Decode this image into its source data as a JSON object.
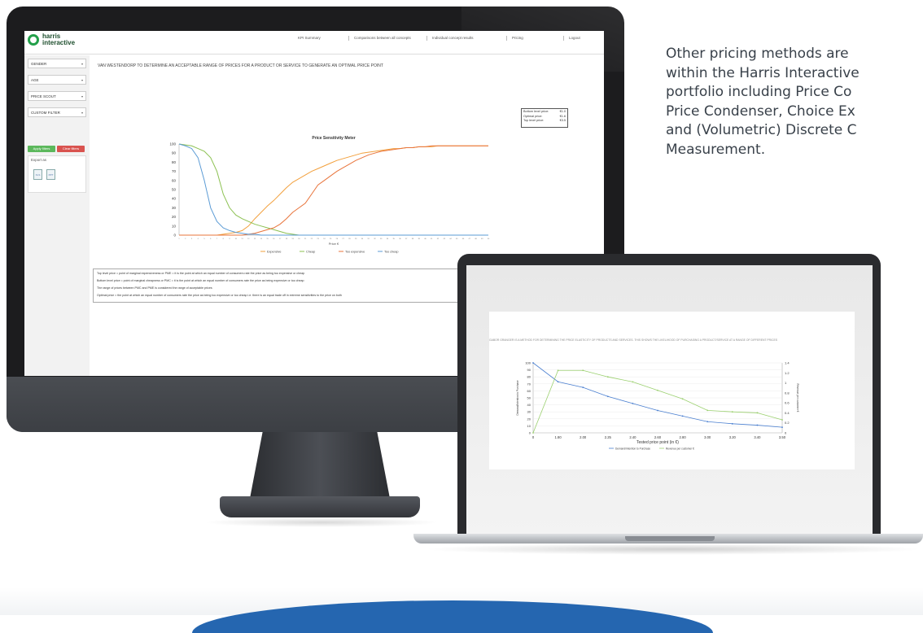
{
  "side_text": [
    "Other pricing methods are",
    "within the Harris Interactive",
    "portfolio including Price Co",
    "Price Condenser, Choice Ex",
    "and (Volumetric) Discrete C",
    "Measurement."
  ],
  "monitor": {
    "logo": {
      "line1": "harris",
      "line2": "interactive"
    },
    "nav": [
      "KPI Summary",
      "Comparisons between all concepts",
      "Individual concept results",
      "Pricing",
      "Logout"
    ],
    "filters": [
      "GENDER",
      "AGE",
      "PRICE SCOUT",
      "CUSTOM FILTER"
    ],
    "apply_label": "Apply filters",
    "clear_label": "Clear filters",
    "export_label": "Export as",
    "export_icons": [
      "XLS",
      "PPT"
    ],
    "title": "VAN WESTENDORP TO DETERMINE AN ACCEPTABLE RANGE OF PRICES FOR A PRODUCT OR SERVICE TO GENERATE AN OPTIMAL PRICE POINT",
    "price_box": [
      {
        "label": "Bottom level price:",
        "value": "€1.0"
      },
      {
        "label": "Optimal price:",
        "value": "€1.6"
      },
      {
        "label": "Top level price:",
        "value": "€3.5"
      }
    ],
    "description": [
      "Top level price = point of marginal expensiveness or PME = it is the point at which an equal number of consumers rate the price as being too expensive or cheap",
      "Bottom level price = point of marginal cheapness or PMC = it is the point at which an equal number of consumers rate the price as being expensive or too cheap",
      "The range of prices between PMC and PME is considered the range of acceptable prices",
      "Optimal price = the point at which an equal number of consumers rate the price as being too expensive or too cheap i.e. there is an equal trade off in extreme sensitivities to the price on both"
    ]
  },
  "chart_data": [
    {
      "type": "line",
      "title": "Price Sensitivity Meter",
      "xlabel": "Price €",
      "ylabel": "",
      "ylim": [
        0,
        100
      ],
      "yticks": [
        0,
        10,
        20,
        30,
        40,
        50,
        60,
        70,
        80,
        90,
        100
      ],
      "x": [
        1,
        2,
        3,
        4,
        5,
        6,
        7,
        8,
        9,
        10,
        11,
        12,
        13,
        14,
        15,
        16,
        17,
        18,
        19,
        20,
        21,
        22,
        23,
        24,
        25,
        26,
        27,
        28,
        29,
        30,
        31,
        32,
        33,
        34,
        35,
        36,
        37,
        38,
        39,
        40,
        41,
        42,
        43,
        44,
        45,
        46,
        47,
        48,
        49,
        50
      ],
      "legend_position": "bottom",
      "series": [
        {
          "name": "Expensive",
          "color": "#f2a03d",
          "values": [
            0,
            0,
            0,
            0,
            0,
            0,
            0,
            1,
            2,
            3,
            5,
            10,
            18,
            25,
            32,
            38,
            45,
            52,
            58,
            62,
            66,
            70,
            73,
            76,
            79,
            82,
            84,
            86,
            88,
            90,
            91,
            92,
            93,
            94,
            95,
            95,
            96,
            96,
            97,
            97,
            97,
            98,
            98,
            98,
            98,
            98,
            98,
            98,
            98,
            98
          ]
        },
        {
          "name": "Cheap",
          "color": "#8cc152",
          "values": [
            100,
            99,
            98,
            95,
            92,
            85,
            70,
            45,
            30,
            22,
            18,
            15,
            12,
            10,
            8,
            6,
            4,
            2,
            1,
            0,
            0,
            0,
            0,
            0,
            0,
            0,
            0,
            0,
            0,
            0,
            0,
            0,
            0,
            0,
            0,
            0,
            0,
            0,
            0,
            0,
            0,
            0,
            0,
            0,
            0,
            0,
            0,
            0,
            0,
            0
          ]
        },
        {
          "name": "Too expensive",
          "color": "#e8743b",
          "values": [
            0,
            0,
            0,
            0,
            0,
            0,
            0,
            0,
            0,
            0,
            0,
            1,
            2,
            4,
            6,
            8,
            12,
            18,
            25,
            30,
            35,
            45,
            55,
            60,
            65,
            70,
            74,
            78,
            82,
            85,
            88,
            90,
            92,
            93,
            94,
            95,
            96,
            96,
            97,
            97,
            98,
            98,
            98,
            98,
            98,
            98,
            98,
            98,
            98,
            98
          ]
        },
        {
          "name": "Too cheap",
          "color": "#5b9bd5",
          "values": [
            100,
            98,
            95,
            85,
            60,
            30,
            15,
            8,
            5,
            3,
            2,
            1,
            1,
            0,
            0,
            0,
            0,
            0,
            0,
            0,
            0,
            0,
            0,
            0,
            0,
            0,
            0,
            0,
            0,
            0,
            0,
            0,
            0,
            0,
            0,
            0,
            0,
            0,
            0,
            0,
            0,
            0,
            0,
            0,
            0,
            0,
            0,
            0,
            0,
            0
          ]
        }
      ]
    },
    {
      "type": "line",
      "title": "",
      "xlabel": "Tested price point (in €)",
      "ylabel": "Demand/Intention to Purchase",
      "y2label": "Revenue per customer €",
      "categories": [
        "0",
        "1.80",
        "2.00",
        "2.25",
        "2.40",
        "2.60",
        "2.80",
        "3.00",
        "3.20",
        "3.40",
        "3.50"
      ],
      "ylim": [
        0,
        100
      ],
      "yticks": [
        0,
        10,
        20,
        30,
        40,
        50,
        60,
        70,
        80,
        90,
        100
      ],
      "y2lim": [
        0,
        1.4
      ],
      "y2ticks": [
        "0",
        "0.2",
        "0.4",
        "0.6",
        "0.8",
        "1",
        "1.2",
        "1.4"
      ],
      "legend_position": "bottom",
      "series": [
        {
          "name": "Demand/Intention to Purchase",
          "color": "#4a7fd0",
          "axis": "left",
          "values": [
            100,
            73,
            65,
            52,
            42,
            32,
            24,
            16,
            13,
            11,
            8
          ]
        },
        {
          "name": "Revenue per customer €",
          "color": "#9bd06f",
          "axis": "right",
          "values": [
            0,
            1.25,
            1.25,
            1.12,
            1.02,
            0.85,
            0.68,
            0.45,
            0.42,
            0.4,
            0.26
          ]
        }
      ]
    }
  ],
  "laptop": {
    "heading": "GABOR GRANGER IS A METHOD FOR DETERMINING THE PRICE ELASTICITY OF PRODUCTS AND SERVICES. THIS SHOWS THE LIKELIHOOD OF PURCHASING A PRODUCT/SERVICE AT A RANGE OF DIFFERENT PRICES"
  }
}
